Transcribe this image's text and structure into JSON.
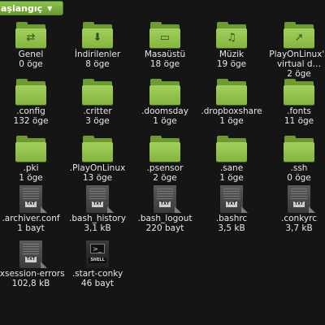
{
  "location": {
    "label": "aşlangıç"
  },
  "items": [
    {
      "name": "Genel",
      "meta": "0 öge",
      "type": "folder",
      "emblem": "share-icon"
    },
    {
      "name": "İndirilenler",
      "meta": "8 öge",
      "type": "folder",
      "emblem": "download-icon"
    },
    {
      "name": "Masaüstü",
      "meta": "18 öge",
      "type": "folder",
      "emblem": "desktop-icon"
    },
    {
      "name": "Müzik",
      "meta": "19 öge",
      "type": "folder",
      "emblem": "music-icon"
    },
    {
      "name": "PlayOnLinux's virtual d…",
      "meta": "2 öge",
      "type": "folder",
      "emblem": "link-icon"
    },
    {
      "name": ".config",
      "meta": "132 öge",
      "type": "folder"
    },
    {
      "name": ".critter",
      "meta": "3 öge",
      "type": "folder"
    },
    {
      "name": ".doomsday",
      "meta": "1 öge",
      "type": "folder"
    },
    {
      "name": ".dropboxshare",
      "meta": "1 öge",
      "type": "folder"
    },
    {
      "name": ".fonts",
      "meta": "11 öge",
      "type": "folder"
    },
    {
      "name": ".pki",
      "meta": "1 öge",
      "type": "folder"
    },
    {
      "name": ".PlayOnLinux",
      "meta": "13 öge",
      "type": "folder"
    },
    {
      "name": ".psensor",
      "meta": "2 öge",
      "type": "folder"
    },
    {
      "name": ".sane",
      "meta": "1 öge",
      "type": "folder"
    },
    {
      "name": ".ssh",
      "meta": "0 öge",
      "type": "folder"
    },
    {
      "name": ".archiver.conf",
      "meta": "1 bayt",
      "type": "text",
      "tag": "TXT"
    },
    {
      "name": ".bash_history",
      "meta": "3,1 kB",
      "type": "text",
      "tag": "TXT"
    },
    {
      "name": ".bash_logout",
      "meta": "220 bayt",
      "type": "text",
      "tag": "TXT"
    },
    {
      "name": ".bashrc",
      "meta": "3,5 kB",
      "type": "text",
      "tag": "TXT"
    },
    {
      "name": ".conkyrc",
      "meta": "3,7 kB",
      "type": "text",
      "tag": "TXT"
    },
    {
      "name": ".xsession-errors",
      "meta": "102,8 kB",
      "type": "text",
      "tag": "TXT"
    },
    {
      "name": ".start-conky",
      "meta": "46 bayt",
      "type": "shell",
      "tag": "SHELL"
    }
  ]
}
